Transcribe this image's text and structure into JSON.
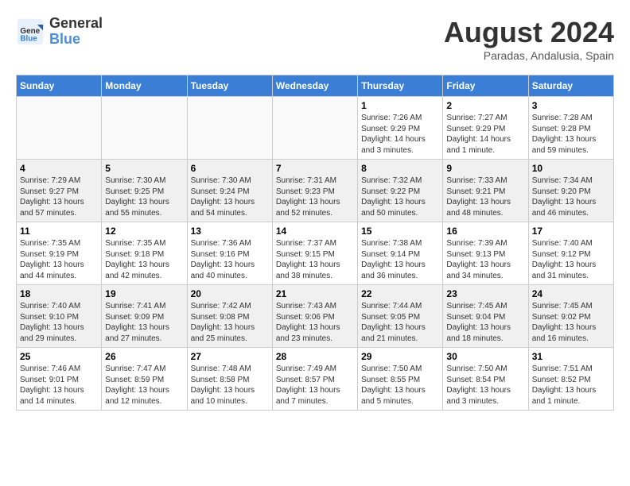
{
  "header": {
    "logo_general": "General",
    "logo_blue": "Blue",
    "month_year": "August 2024",
    "location": "Paradas, Andalusia, Spain"
  },
  "weekdays": [
    "Sunday",
    "Monday",
    "Tuesday",
    "Wednesday",
    "Thursday",
    "Friday",
    "Saturday"
  ],
  "weeks": [
    [
      {
        "day": "",
        "info": ""
      },
      {
        "day": "",
        "info": ""
      },
      {
        "day": "",
        "info": ""
      },
      {
        "day": "",
        "info": ""
      },
      {
        "day": "1",
        "info": "Sunrise: 7:26 AM\nSunset: 9:29 PM\nDaylight: 14 hours\nand 3 minutes."
      },
      {
        "day": "2",
        "info": "Sunrise: 7:27 AM\nSunset: 9:29 PM\nDaylight: 14 hours\nand 1 minute."
      },
      {
        "day": "3",
        "info": "Sunrise: 7:28 AM\nSunset: 9:28 PM\nDaylight: 13 hours\nand 59 minutes."
      }
    ],
    [
      {
        "day": "4",
        "info": "Sunrise: 7:29 AM\nSunset: 9:27 PM\nDaylight: 13 hours\nand 57 minutes."
      },
      {
        "day": "5",
        "info": "Sunrise: 7:30 AM\nSunset: 9:25 PM\nDaylight: 13 hours\nand 55 minutes."
      },
      {
        "day": "6",
        "info": "Sunrise: 7:30 AM\nSunset: 9:24 PM\nDaylight: 13 hours\nand 54 minutes."
      },
      {
        "day": "7",
        "info": "Sunrise: 7:31 AM\nSunset: 9:23 PM\nDaylight: 13 hours\nand 52 minutes."
      },
      {
        "day": "8",
        "info": "Sunrise: 7:32 AM\nSunset: 9:22 PM\nDaylight: 13 hours\nand 50 minutes."
      },
      {
        "day": "9",
        "info": "Sunrise: 7:33 AM\nSunset: 9:21 PM\nDaylight: 13 hours\nand 48 minutes."
      },
      {
        "day": "10",
        "info": "Sunrise: 7:34 AM\nSunset: 9:20 PM\nDaylight: 13 hours\nand 46 minutes."
      }
    ],
    [
      {
        "day": "11",
        "info": "Sunrise: 7:35 AM\nSunset: 9:19 PM\nDaylight: 13 hours\nand 44 minutes."
      },
      {
        "day": "12",
        "info": "Sunrise: 7:35 AM\nSunset: 9:18 PM\nDaylight: 13 hours\nand 42 minutes."
      },
      {
        "day": "13",
        "info": "Sunrise: 7:36 AM\nSunset: 9:16 PM\nDaylight: 13 hours\nand 40 minutes."
      },
      {
        "day": "14",
        "info": "Sunrise: 7:37 AM\nSunset: 9:15 PM\nDaylight: 13 hours\nand 38 minutes."
      },
      {
        "day": "15",
        "info": "Sunrise: 7:38 AM\nSunset: 9:14 PM\nDaylight: 13 hours\nand 36 minutes."
      },
      {
        "day": "16",
        "info": "Sunrise: 7:39 AM\nSunset: 9:13 PM\nDaylight: 13 hours\nand 34 minutes."
      },
      {
        "day": "17",
        "info": "Sunrise: 7:40 AM\nSunset: 9:12 PM\nDaylight: 13 hours\nand 31 minutes."
      }
    ],
    [
      {
        "day": "18",
        "info": "Sunrise: 7:40 AM\nSunset: 9:10 PM\nDaylight: 13 hours\nand 29 minutes."
      },
      {
        "day": "19",
        "info": "Sunrise: 7:41 AM\nSunset: 9:09 PM\nDaylight: 13 hours\nand 27 minutes."
      },
      {
        "day": "20",
        "info": "Sunrise: 7:42 AM\nSunset: 9:08 PM\nDaylight: 13 hours\nand 25 minutes."
      },
      {
        "day": "21",
        "info": "Sunrise: 7:43 AM\nSunset: 9:06 PM\nDaylight: 13 hours\nand 23 minutes."
      },
      {
        "day": "22",
        "info": "Sunrise: 7:44 AM\nSunset: 9:05 PM\nDaylight: 13 hours\nand 21 minutes."
      },
      {
        "day": "23",
        "info": "Sunrise: 7:45 AM\nSunset: 9:04 PM\nDaylight: 13 hours\nand 18 minutes."
      },
      {
        "day": "24",
        "info": "Sunrise: 7:45 AM\nSunset: 9:02 PM\nDaylight: 13 hours\nand 16 minutes."
      }
    ],
    [
      {
        "day": "25",
        "info": "Sunrise: 7:46 AM\nSunset: 9:01 PM\nDaylight: 13 hours\nand 14 minutes."
      },
      {
        "day": "26",
        "info": "Sunrise: 7:47 AM\nSunset: 8:59 PM\nDaylight: 13 hours\nand 12 minutes."
      },
      {
        "day": "27",
        "info": "Sunrise: 7:48 AM\nSunset: 8:58 PM\nDaylight: 13 hours\nand 10 minutes."
      },
      {
        "day": "28",
        "info": "Sunrise: 7:49 AM\nSunset: 8:57 PM\nDaylight: 13 hours\nand 7 minutes."
      },
      {
        "day": "29",
        "info": "Sunrise: 7:50 AM\nSunset: 8:55 PM\nDaylight: 13 hours\nand 5 minutes."
      },
      {
        "day": "30",
        "info": "Sunrise: 7:50 AM\nSunset: 8:54 PM\nDaylight: 13 hours\nand 3 minutes."
      },
      {
        "day": "31",
        "info": "Sunrise: 7:51 AM\nSunset: 8:52 PM\nDaylight: 13 hours\nand 1 minute."
      }
    ]
  ]
}
